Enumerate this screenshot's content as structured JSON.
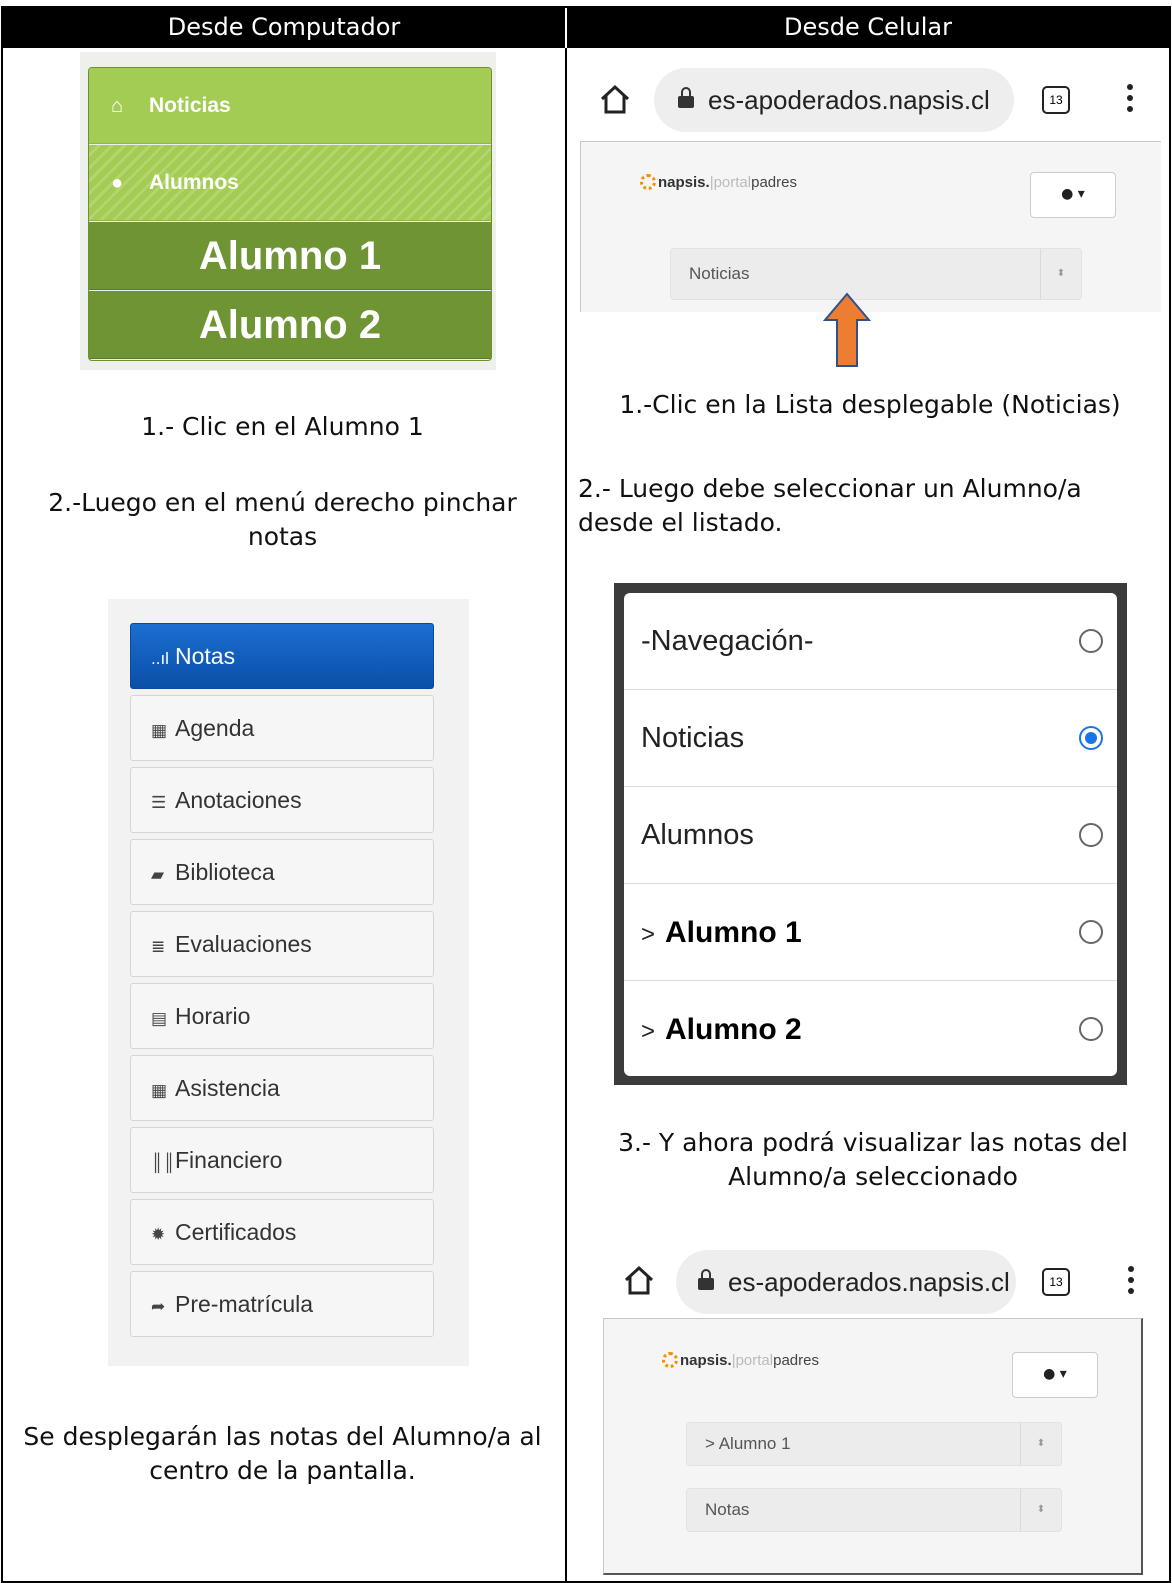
{
  "headers": {
    "left": "Desde Computador",
    "right": "Desde Celular"
  },
  "desktop": {
    "green_menu": {
      "noticias": "Noticias",
      "alumnos": "Alumnos",
      "alumno1": "Alumno 1",
      "alumno2": "Alumno 2"
    },
    "step1": "1.- Clic en el Alumno 1",
    "step2": "2.-Luego en el menú derecho pinchar notas",
    "nav": [
      {
        "icon": "signal-icon",
        "glyph": "..ıl",
        "label": "Notas",
        "active": true
      },
      {
        "icon": "grid-icon",
        "glyph": "▦",
        "label": "Agenda"
      },
      {
        "icon": "list-icon",
        "glyph": "☰",
        "label": "Anotaciones"
      },
      {
        "icon": "book-icon",
        "glyph": "▰",
        "label": "Biblioteca"
      },
      {
        "icon": "list-icon",
        "glyph": "≣",
        "label": "Evaluaciones"
      },
      {
        "icon": "table-icon",
        "glyph": "▤",
        "label": "Horario"
      },
      {
        "icon": "calendar-icon",
        "glyph": "▦",
        "label": "Asistencia"
      },
      {
        "icon": "barcode-icon",
        "glyph": "║║",
        "label": "Financiero"
      },
      {
        "icon": "certificate-icon",
        "glyph": "✹",
        "label": "Certificados"
      },
      {
        "icon": "share-arrow-icon",
        "glyph": "➦",
        "label": "Pre-matrícula"
      }
    ],
    "footer": "Se desplegarán las notas del Alumno/a al centro de la pantalla."
  },
  "mobile": {
    "url": "es-apoderados.napsis.cl",
    "tab_count": "13",
    "logo": {
      "a": "napsis.",
      "b": "|portal",
      "c": "padres"
    },
    "select_top": "Noticias",
    "step1": "1.-Clic en la Lista desplegable (Noticias)",
    "step2": "2.- Luego debe seleccionar un Alumno/a desde el listado.",
    "list": [
      {
        "label": "-Navegación-",
        "selected": false,
        "bold": false
      },
      {
        "label": "Noticias",
        "selected": true,
        "bold": false
      },
      {
        "label": "Alumnos",
        "selected": false,
        "bold": false
      },
      {
        "label": "Alumno 1",
        "prefix": ">",
        "selected": false,
        "bold": true
      },
      {
        "label": "Alumno 2",
        "prefix": ">",
        "selected": false,
        "bold": true
      }
    ],
    "step3": "3.- Y ahora podrá visualizar las notas del Alumno/a seleccionado",
    "select_student": "> Alumno 1",
    "select_notas": "Notas"
  },
  "colors": {
    "arrow": "#ed7d31",
    "green_light": "#a3cc55",
    "green_dark": "#6e9434",
    "nav_active": "#0b5cbf"
  }
}
